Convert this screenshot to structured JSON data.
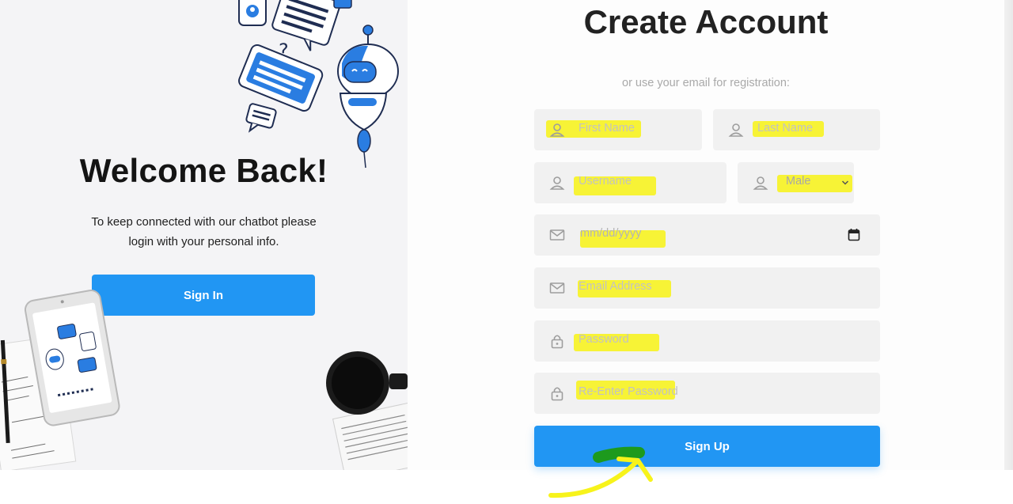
{
  "welcome": {
    "title": "Welcome Back!",
    "text_line1": "To keep connected with our chatbot please",
    "text_line2": "login with your personal info.",
    "signin_label": "Sign In"
  },
  "register": {
    "title": "Create Account",
    "note": "or use your email for registration:",
    "first_name_placeholder": "First Name",
    "last_name_placeholder": "Last Name",
    "username_placeholder": "Username",
    "gender_value": "Male",
    "dob_placeholder": "mm/dd/yyyy",
    "email_placeholder": "Email Address",
    "password_placeholder": "Password",
    "reenter_placeholder": "Re-Enter Password",
    "signup_label": "Sign Up"
  },
  "icons": {
    "first_name": "user-icon",
    "last_name": "user-icon",
    "username": "user-icon",
    "gender": "user-icon",
    "dob": "mail-icon",
    "email": "mail-icon",
    "password": "lock-icon",
    "reenter": "lock-icon",
    "calendar": "calendar-icon",
    "dropdown": "chevron-down-icon"
  },
  "colors": {
    "accent": "#2196f3",
    "field_bg": "#f1f1f1",
    "highlight": "#f7f31b",
    "arrow_green": "#1d9a1d"
  }
}
